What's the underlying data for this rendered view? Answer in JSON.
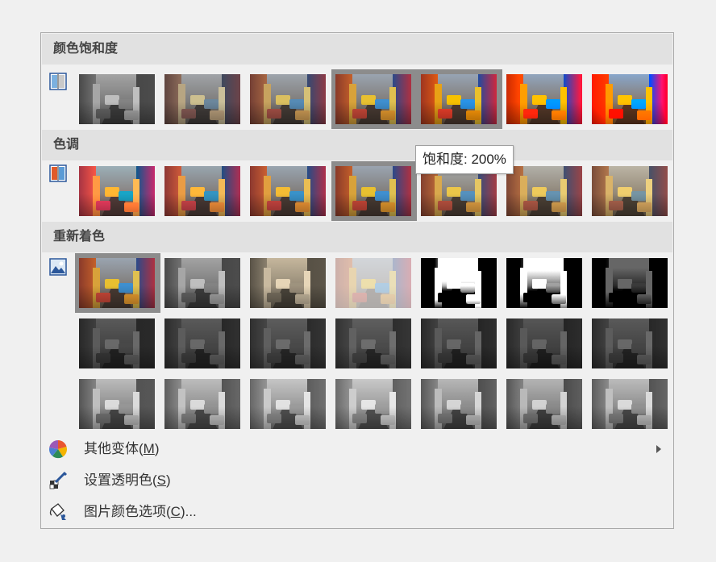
{
  "sections": {
    "saturation": {
      "title": "颜色饱和度"
    },
    "tone": {
      "title": "色调"
    },
    "recolor": {
      "title": "重新着色"
    }
  },
  "tooltip": "饱和度: 200%",
  "menu": {
    "more_variations": {
      "label": "其他变体(M)",
      "prefix": "其他变体(",
      "key": "M",
      "suffix": ")"
    },
    "set_transparent": {
      "label": "设置透明色(S)",
      "prefix": "设置透明色(",
      "key": "S",
      "suffix": ")"
    },
    "color_options": {
      "label": "图片颜色选项(C)...",
      "prefix": "图片颜色选项(",
      "key": "C",
      "suffix": ")..."
    }
  },
  "colors": {
    "header_bg": "#e1e1e1",
    "selected_border": "#8c8c8c"
  }
}
